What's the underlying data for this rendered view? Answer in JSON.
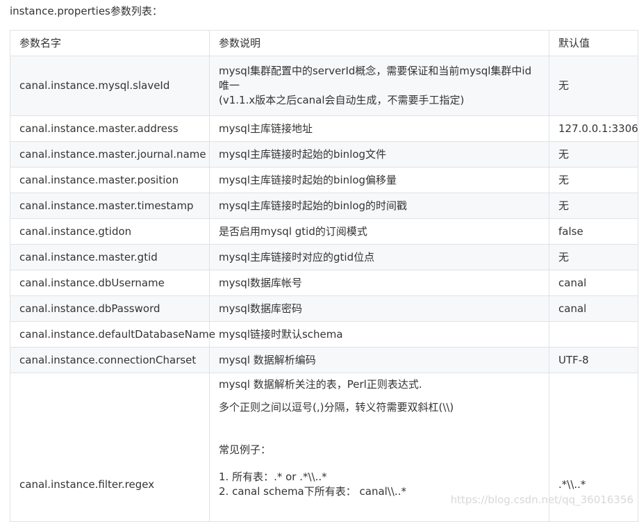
{
  "intro": "instance.properties参数列表：",
  "table": {
    "headers": [
      "参数名字",
      "参数说明",
      "默认值"
    ],
    "rows": [
      {
        "name": "canal.instance.mysql.slaveId",
        "desc_lines": [
          "mysql集群配置中的serverId概念，需要保证和当前mysql集群中id",
          "唯一",
          "(v1.1.x版本之后canal会自动生成，不需要手工指定)"
        ],
        "default": "无"
      },
      {
        "name": "canal.instance.master.address",
        "desc": "mysql主库链接地址",
        "default": "127.0.0.1:3306"
      },
      {
        "name": "canal.instance.master.journal.name",
        "desc": "mysql主库链接时起始的binlog文件",
        "default": "无"
      },
      {
        "name": "canal.instance.master.position",
        "desc": "mysql主库链接时起始的binlog偏移量",
        "default": "无"
      },
      {
        "name": "canal.instance.master.timestamp",
        "desc": "mysql主库链接时起始的binlog的时间戳",
        "default": "无"
      },
      {
        "name": "canal.instance.gtidon",
        "desc": "是否启用mysql gtid的订阅模式",
        "default": "false"
      },
      {
        "name": "canal.instance.master.gtid",
        "desc": "mysql主库链接时对应的gtid位点",
        "default": "无"
      },
      {
        "name": "canal.instance.dbUsername",
        "desc": "mysql数据库帐号",
        "default": "canal"
      },
      {
        "name": "canal.instance.dbPassword",
        "desc": "mysql数据库密码",
        "default": "canal"
      },
      {
        "name": "canal.instance.defaultDatabaseName",
        "desc": "mysql链接时默认schema",
        "default": ""
      },
      {
        "name": "canal.instance.connectionCharset",
        "desc": "mysql 数据解析编码",
        "default": "UTF-8"
      },
      {
        "name": "canal.instance.filter.regex",
        "desc_lines": [
          "mysql 数据解析关注的表，Perl正则表达式.",
          "多个正则之间以逗号(,)分隔，转义符需要双斜杠(\\\\)",
          "常见例子：",
          "1.  所有表：.*   or  .*\\\\..*",
          "2.  canal schema下所有表： canal\\\\..*"
        ],
        "default": ".*\\\\..*"
      }
    ]
  },
  "watermark": "https://blog.csdn.net/qq_36016356"
}
